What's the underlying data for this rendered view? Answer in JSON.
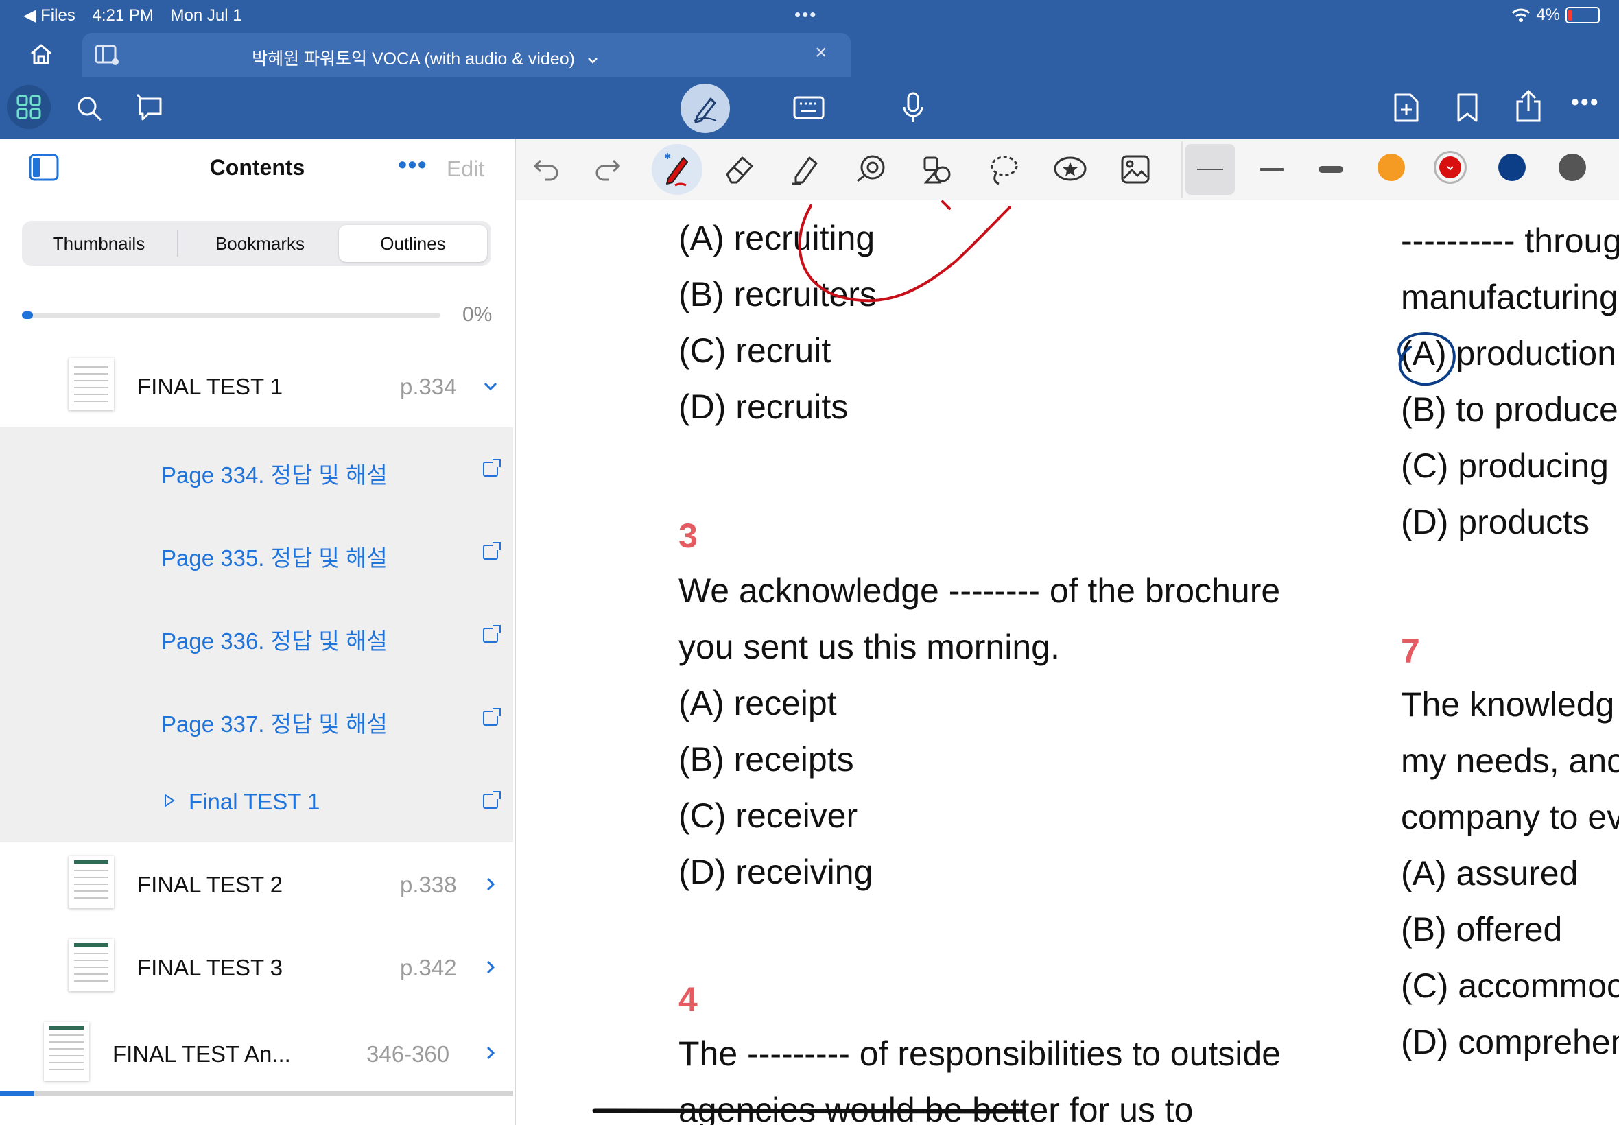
{
  "status_bar": {
    "back_app": "Files",
    "time": "4:21 PM",
    "date": "Mon Jul 1",
    "battery": "4%"
  },
  "tab": {
    "title": "박혜원 파워토익 VOCA (with audio & video)"
  },
  "sidebar": {
    "title": "Contents",
    "edit_label": "Edit",
    "segments": [
      "Thumbnails",
      "Bookmarks",
      "Outlines"
    ],
    "selected_segment": "Outlines",
    "progress": {
      "label": "0%",
      "value": 0.02
    },
    "rows": [
      {
        "label": "FINAL TEST 1",
        "page": "p.334",
        "expanded": true
      },
      {
        "label": "Page 334. 정답 및 해설"
      },
      {
        "label": "Page 335. 정답 및 해설"
      },
      {
        "label": "Page 336. 정답 및 해설"
      },
      {
        "label": "Page 337. 정답 및 해설"
      },
      {
        "label": "Final TEST 1"
      },
      {
        "label": "FINAL TEST 2",
        "page": "p.338"
      },
      {
        "label": "FINAL TEST 3",
        "page": "p.342"
      },
      {
        "label": "FINAL TEST An...",
        "page": "346-360"
      }
    ]
  },
  "toolbar": {
    "colors": [
      "#f59a22",
      "#d70f0f",
      "#0b3e86",
      "#555555"
    ],
    "selected_color": "#d70f0f"
  },
  "document": {
    "left_column": {
      "q2_options": [
        "(A) recruiting",
        "(B) recruiters",
        "(C) recruit",
        "(D) recruits"
      ],
      "q3_number": "3",
      "q3_text": [
        "We acknowledge -------- of the brochure",
        "you sent us this morning."
      ],
      "q3_options": [
        "(A) receipt",
        "(B) receipts",
        "(C) receiver",
        "(D) receiving"
      ],
      "q4_number": "4",
      "q4_text": [
        "The --------- of responsibilities to outside",
        "agencies would be better for us to"
      ]
    },
    "right_column": {
      "q6_text": [
        "---------- throug",
        "manufacturing"
      ],
      "q6_options": [
        "(A) production",
        "(B) to produce",
        "(C) producing",
        "(D) products"
      ],
      "q7_number": "7",
      "q7_text": [
        "The knowledg",
        "my needs, anc",
        "company to ev"
      ],
      "q7_options": [
        "(A) assured",
        "(B) offered",
        "(C) accommoc",
        "(D) comprehen"
      ]
    }
  }
}
